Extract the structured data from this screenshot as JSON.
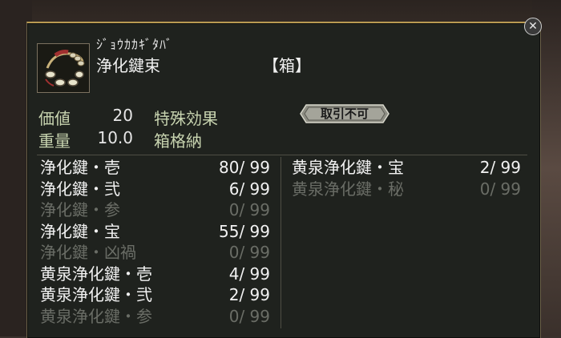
{
  "item": {
    "reading": "ｼﾞｮｳｶｶｷﾞﾀﾊﾞ",
    "name": "浄化鍵束",
    "type": "【箱】",
    "icon": "key-ring-icon"
  },
  "stats": {
    "value_label": "価値",
    "value": "20",
    "weight_label": "重量",
    "weight": "10.0",
    "effect_label": "特殊効果",
    "storage_label": "箱格納",
    "trade_badge": "取引不可"
  },
  "left_list": [
    {
      "name": "浄化鍵・壱",
      "count": "80/ 99",
      "active": true
    },
    {
      "name": "浄化鍵・弐",
      "count": "6/ 99",
      "active": true
    },
    {
      "name": "浄化鍵・参",
      "count": "0/ 99",
      "active": false
    },
    {
      "name": "浄化鍵・宝",
      "count": "55/ 99",
      "active": true
    },
    {
      "name": "浄化鍵・凶禍",
      "count": "0/ 99",
      "active": false
    },
    {
      "name": "黄泉浄化鍵・壱",
      "count": "4/ 99",
      "active": true
    },
    {
      "name": "黄泉浄化鍵・弐",
      "count": "2/ 99",
      "active": true
    },
    {
      "name": "黄泉浄化鍵・参",
      "count": "0/ 99",
      "active": false
    }
  ],
  "right_list": [
    {
      "name": "黄泉浄化鍵・宝",
      "count": "2/ 99",
      "active": true
    },
    {
      "name": "黄泉浄化鍵・秘",
      "count": "0/ 99",
      "active": false
    }
  ],
  "close_label": "✕",
  "colors": {
    "accent_border": "#b89a52",
    "panel_bg": "#1f221e",
    "label_green": "#c8d4b0",
    "inactive": "#6a6d66"
  }
}
